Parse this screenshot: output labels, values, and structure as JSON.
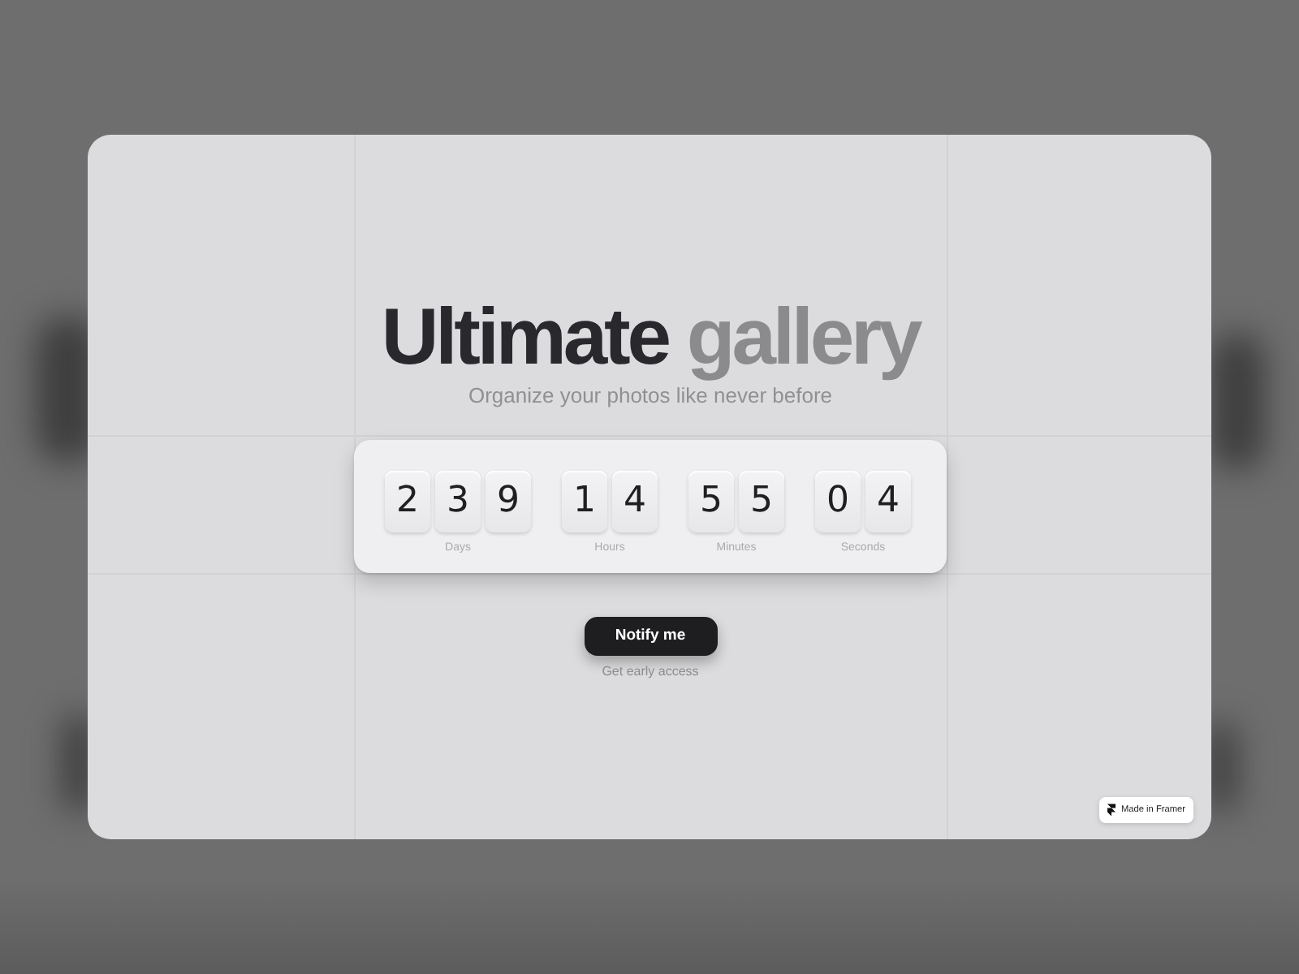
{
  "hero": {
    "title": [
      {
        "text": "Ultimate",
        "kind": "primary"
      },
      {
        "text": "gallery",
        "kind": "secondary"
      }
    ],
    "subtitle": "Organize your photos like never before"
  },
  "countdown": {
    "units": [
      {
        "digits": [
          "2",
          "3",
          "9"
        ],
        "label": "Days"
      },
      {
        "digits": [
          "1",
          "4"
        ],
        "label": "Hours"
      },
      {
        "digits": [
          "5",
          "5"
        ],
        "label": "Minutes"
      },
      {
        "digits": [
          "0",
          "4"
        ],
        "label": "Seconds"
      }
    ]
  },
  "cta": {
    "button": "Notify me",
    "caption": "Get early access"
  },
  "badge": {
    "label": "Made in Framer"
  }
}
